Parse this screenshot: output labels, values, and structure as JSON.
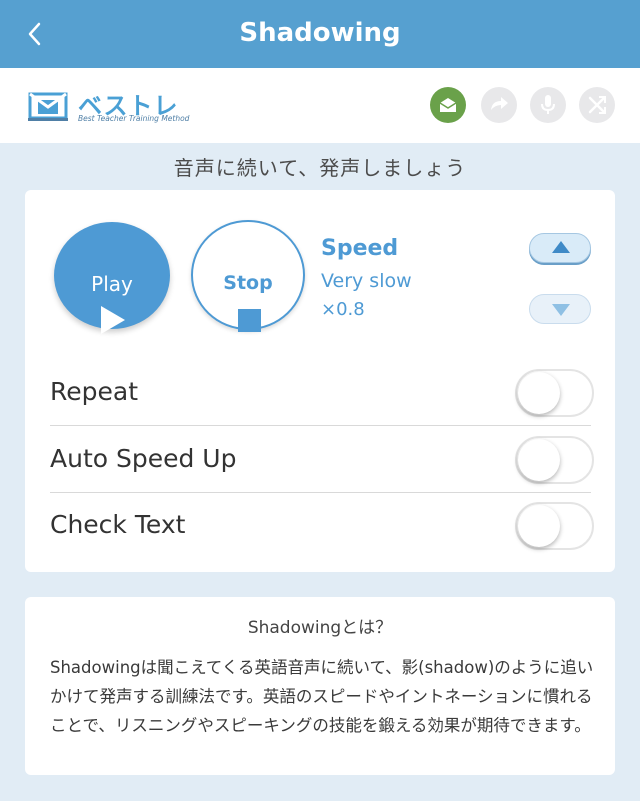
{
  "nav": {
    "title": "Shadowing"
  },
  "brand": {
    "name": "ベストレ",
    "tagline": "Best Teacher Training Method"
  },
  "toolbar": {
    "icons": [
      "envelope-icon",
      "redo-icon",
      "microphone-icon",
      "shuffle-icon"
    ],
    "active_color": "#6aa14a"
  },
  "instruction": "音声に続いて、発声しましょう",
  "player": {
    "play_label": "Play",
    "stop_label": "Stop",
    "speed_title": "Speed",
    "speed_mode": "Very slow",
    "speed_rate": "×0.8"
  },
  "settings": [
    {
      "label": "Repeat",
      "on": false
    },
    {
      "label": "Auto Speed Up",
      "on": false
    },
    {
      "label": "Check Text",
      "on": false
    }
  ],
  "info": {
    "title": "Shadowingとは？",
    "body": "Shadowingは聞こえてくる英語音声に続いて、影(shadow)のように追いかけて発声する訓練法です。英語のスピードやイントネーションに慣れることで、リスニングやスピーキングの技能を鍛える効果が期待できます。"
  },
  "colors": {
    "primary": "#56a0d0",
    "accent": "#4e9ad4",
    "background": "#e1ecf5"
  }
}
